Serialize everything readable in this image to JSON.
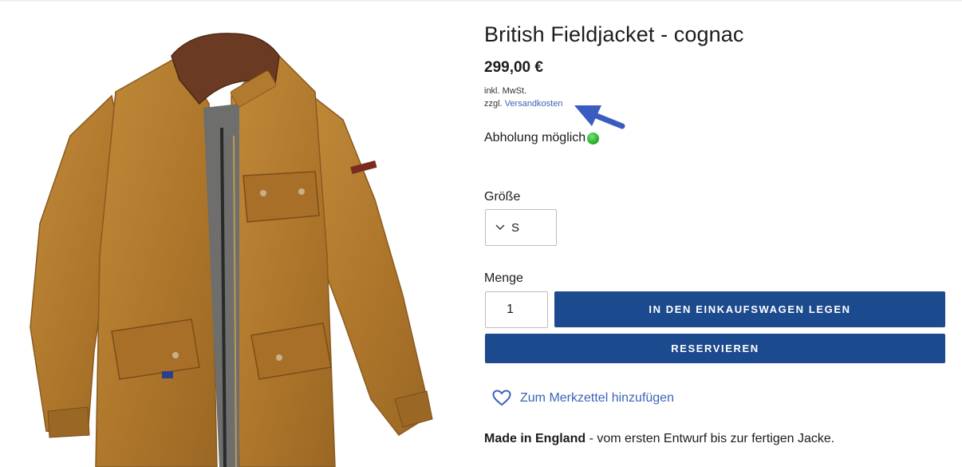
{
  "product": {
    "title": "British Fieldjacket - cognac",
    "price": "299,00 €",
    "tax_note": "inkl. MwSt.",
    "shipping_prefix": "zzgl. ",
    "shipping_link": "Versandkosten",
    "pickup": "Abholung möglich",
    "size_label": "Größe",
    "size_value": "S",
    "quantity_label": "Menge",
    "quantity_value": "1",
    "add_to_cart": "IN DEN EINKAUFSWAGEN LEGEN",
    "reserve": "RESERVIEREN",
    "wishlist": "Zum Merkzettel hinzufügen",
    "made_in_bold": "Made in England",
    "made_in_rest": " - vom ersten Entwurf bis zur fertigen Jacke."
  },
  "colors": {
    "button_bg": "#1c4a8e",
    "link": "#3b63b8",
    "jacket": "#b27a2f",
    "collar": "#6b3a22",
    "availability": "#1ea81e",
    "arrow": "#3a5bbf"
  },
  "icons": [
    "chevron-down-icon",
    "heart-icon",
    "availability-dot-icon",
    "arrow-pointer-icon"
  ]
}
